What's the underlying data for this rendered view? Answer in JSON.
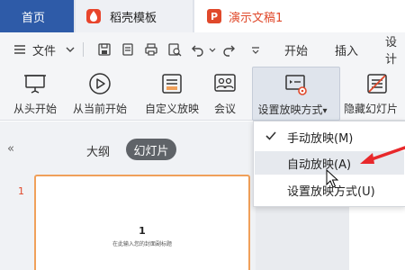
{
  "tabs": {
    "home": "首页",
    "docer": "稻壳模板",
    "document": "演示文稿1"
  },
  "menubar": {
    "file_label": "文件",
    "tab_start": "开始",
    "tab_insert": "插入",
    "tab_design": "设计"
  },
  "ribbon": {
    "buttons": [
      {
        "label": "从头开始",
        "icon": "projector-icon"
      },
      {
        "label": "从当前开始",
        "icon": "play-circle-icon"
      },
      {
        "label": "自定义放映",
        "icon": "custom-show-icon"
      },
      {
        "label": "会议",
        "icon": "meeting-icon"
      },
      {
        "label": "设置放映方式",
        "icon": "slideshow-settings-icon"
      },
      {
        "label": "隐藏幻灯片",
        "icon": "hide-slide-icon"
      }
    ],
    "active_dropdown_caret": "▾"
  },
  "leftpanel": {
    "collapse": "«",
    "tab_outline": "大纲",
    "tab_slides": "幻灯片",
    "slide_number": "1",
    "thumb_title": "1",
    "thumb_subtitle": "在此输入您的封面副标题"
  },
  "dropdown": {
    "items": [
      {
        "label": "手动放映(M)",
        "checked": true
      },
      {
        "label": "自动放映(A)",
        "checked": false,
        "hovered": true
      },
      {
        "label": "设置放映方式(U)",
        "checked": false
      }
    ]
  },
  "colors": {
    "brand_blue": "#2e5ba8",
    "ppt_red": "#e0492b",
    "arrow_red": "#e8282b"
  }
}
